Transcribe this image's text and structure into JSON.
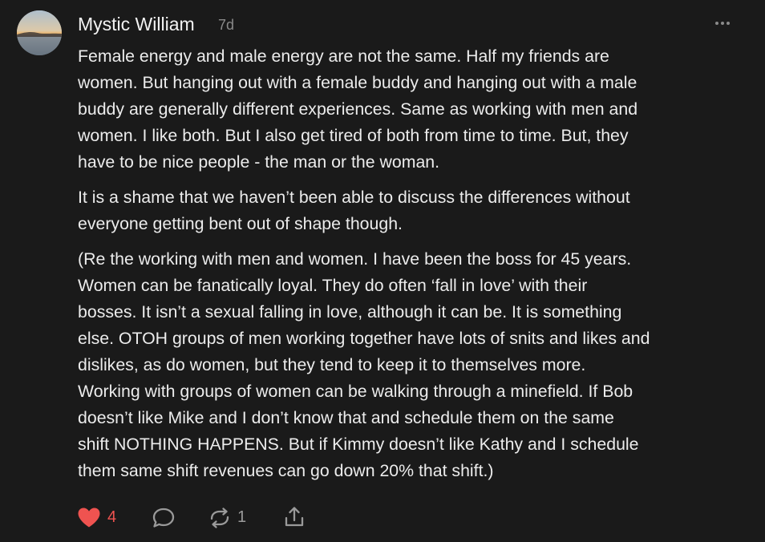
{
  "comment": {
    "author": "Mystic William",
    "time": "7d",
    "paragraphs": [
      "Female energy and male energy are not the same. Half my friends are\nwomen. But hanging out with a female buddy and hanging out with a male\nbuddy are generally different experiences. Same as working with men and\nwomen. I like both. But I also get tired of both from time to time. But, they\nhave to be nice people - the man or the woman.",
      "It is a shame that we haven’t been able to discuss the differences without\neveryone getting bent out of shape though.",
      "(Re the working with men and women. I have been the boss for 45 years.\nWomen can be fanatically loyal. They do often ‘fall in love’ with their\nbosses. It isn’t a sexual falling in love, although it can be. It is something\nelse. OTOH groups of men working together have lots of snits and likes and\ndislikes, as do women, but they tend to keep it to themselves more.\nWorking with groups of women can be walking through a minefield. If Bob\ndoesn’t like Mike and I don’t know that and schedule them on the same\nshift NOTHING HAPPENS. But if Kimmy doesn’t like Kathy and I schedule\nthem same shift revenues can go down 20% that shift.)"
    ],
    "actions": {
      "like_count": "4",
      "restack_count": "1"
    },
    "icons": {
      "avatar": "avatar-landscape",
      "more": "more-horizontal-icon",
      "like": "heart-icon",
      "reply": "comment-bubble-icon",
      "restack": "restack-icon",
      "share": "share-icon"
    },
    "colors": {
      "background": "#1a1a1a",
      "text": "#ececec",
      "muted": "#8a8a8a",
      "like_red": "#ef5350"
    }
  }
}
